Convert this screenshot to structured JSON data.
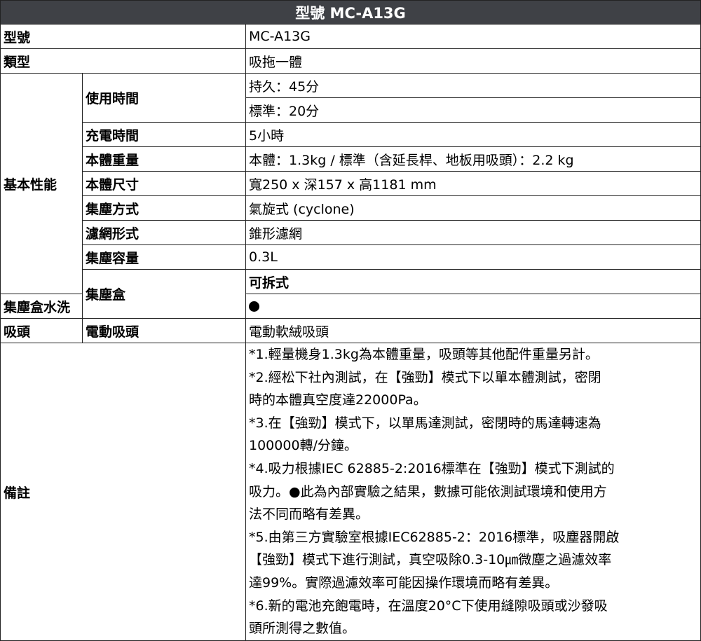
{
  "title": "型號 MC-A13G",
  "rows": {
    "model": {
      "label": "型號",
      "value": "MC-A13G"
    },
    "type": {
      "label": "類型",
      "value": "吸拖一體"
    },
    "basic": {
      "label": "基本性能",
      "usage_time": {
        "label": "使用時間",
        "values": [
          "持久：45分",
          "標準：20分"
        ]
      },
      "charge_time": {
        "label": "充電時間",
        "value": "5小時"
      },
      "weight": {
        "label": "本體重量",
        "value": "本體：1.3kg / 標準（含延長桿、地板用吸頭）：2.2 kg"
      },
      "size": {
        "label": "本體尺寸",
        "value": "寬250 x 深157 x 高1181 mm"
      },
      "dust_method": {
        "label": "集塵方式",
        "value": "氣旋式 (cyclone)"
      },
      "filter": {
        "label": "濾網形式",
        "value": "錐形濾網"
      },
      "capacity": {
        "label": "集塵容量",
        "value": "0.3L"
      }
    },
    "dust_box": {
      "label": "集塵盒",
      "detachable": {
        "label": "可拆式",
        "mark": "●"
      },
      "washable": {
        "label": "集塵盒水洗",
        "mark": "●"
      }
    },
    "head": {
      "label": "吸頭",
      "powered": {
        "label": "電動吸頭",
        "value": "電動軟絨吸頭"
      }
    },
    "notes": {
      "label": "備註",
      "lines": [
        "*1.輕量機身1.3kg為本體重量，吸頭等其他配件重量另計。",
        "*2.經松下社內測試，在【強勁】模式下以單本體測試，密閉",
        "時的本體真空度達22000Pa。",
        "*3.在【強勁】模式下，以單馬達測試，密閉時的馬達轉速為",
        "100000轉/分鐘。",
        "*4.吸力根據IEC 62885-2:2016標準在【強勁】模式下測試的",
        "吸力。●此為內部實驗之結果，數據可能依測試環境和使用方",
        "法不同而略有差異。",
        "*5.由第三方實驗室根據IEC62885-2：2016標準，吸塵器開啟",
        "【強勁】模式下進行測試，真空吸除0.3-10㎛微塵之過濾效率",
        "達99%。實際過濾效率可能因操作環境而略有差異。",
        "*6.新的電池充飽電時，在溫度20°C下使用縫隙吸頭或沙發吸",
        "頭所測得之數值。"
      ]
    }
  }
}
